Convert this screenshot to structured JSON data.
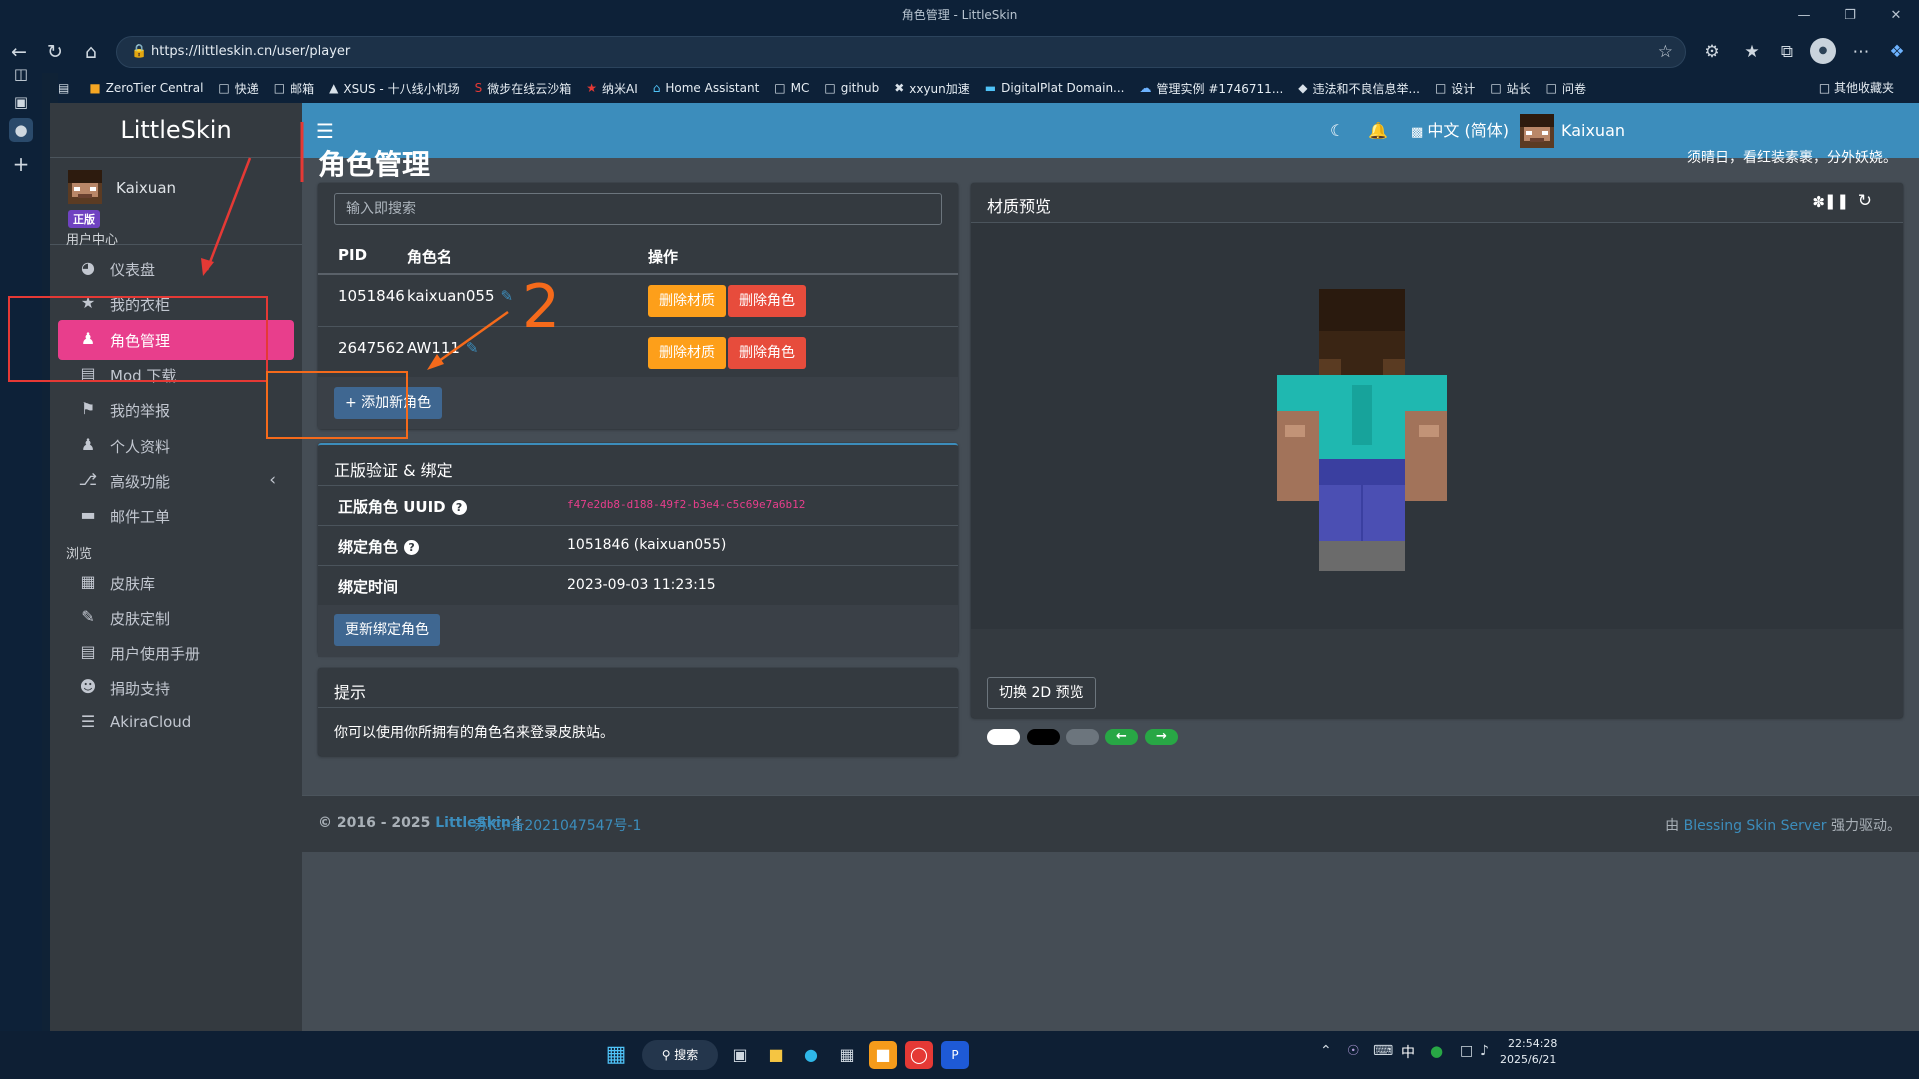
{
  "browser": {
    "window_title": "角色管理 - LittleSkin",
    "url": "https://littleskin.cn/user/player",
    "bookmarks": [
      "ZeroTier Central",
      "快递",
      "邮箱",
      "XSUS - 十八线小机场",
      "微步在线云沙箱",
      "纳米AI",
      "Home Assistant",
      "MC",
      "github",
      "xxyun加速",
      "DigitalPlat Domain...",
      "管理实例 #1746711...",
      "违法和不良信息举...",
      "设计",
      "站长",
      "问卷"
    ],
    "other_bookmarks": "其他收藏夹"
  },
  "app": {
    "brand": "LittleSkin",
    "user": {
      "name": "Kaixuan",
      "badge": "正版"
    },
    "nav_header_user": "用户中心",
    "nav_header_browse": "浏览",
    "nav_user": [
      {
        "label": "仪表盘",
        "icon": "dashboard-icon"
      },
      {
        "label": "我的衣柜",
        "icon": "star-icon"
      },
      {
        "label": "角色管理",
        "icon": "users-icon",
        "active": true
      },
      {
        "label": "Mod 下载",
        "icon": "book-icon"
      },
      {
        "label": "我的举报",
        "icon": "flag-icon"
      },
      {
        "label": "个人资料",
        "icon": "user-icon"
      },
      {
        "label": "高级功能",
        "icon": "branch-icon"
      },
      {
        "label": "邮件工单",
        "icon": "ticket-icon"
      }
    ],
    "nav_browse": [
      {
        "label": "皮肤库",
        "icon": "archive-icon"
      },
      {
        "label": "皮肤定制",
        "icon": "pencil-icon"
      },
      {
        "label": "用户使用手册",
        "icon": "book-icon"
      },
      {
        "label": "捐助支持",
        "icon": "donate-icon"
      },
      {
        "label": "AkiraCloud",
        "icon": "server-icon"
      }
    ],
    "topnav": {
      "language": "中文 (简体)",
      "user": "Kaixuan"
    },
    "page_title": "角色管理",
    "motd": "须晴日，看红装素裹，分外妖娆。",
    "players": {
      "search_placeholder": "输入即搜索",
      "columns": [
        "PID",
        "角色名",
        "操作"
      ],
      "rows": [
        {
          "pid": "1051846",
          "name": "kaixuan055"
        },
        {
          "pid": "2647562",
          "name": "AW111"
        }
      ],
      "delete_texture": "删除材质",
      "delete_player": "删除角色",
      "add_player": "+ 添加新角色"
    },
    "genuine": {
      "title": "正版验证 & 绑定",
      "uuid_label": "正版角色 UUID",
      "uuid": "f47e2db8-d188-49f2-b3e4-c5c69e7a6b12",
      "bound_label": "绑定角色",
      "bound": "1051846 (kaixuan055)",
      "time_label": "绑定时间",
      "time": "2023-09-03 11:23:15",
      "update_button": "更新绑定角色"
    },
    "tips": {
      "title": "提示",
      "text": "你可以使用你所拥有的角色名来登录皮肤站。"
    },
    "preview": {
      "title": "材质预览",
      "toggle_2d": "切换 2D 预览"
    },
    "footer": {
      "copyright": "© 2016 - 2025",
      "site": "LittleSkin",
      "icp": "苏ICP备2021047547号-1",
      "powered_prefix": "由",
      "powered_link": "Blessing Skin Server",
      "powered_suffix": "强力驱动。"
    }
  },
  "taskbar": {
    "search": "搜索",
    "time": "22:54:28",
    "date": "2025/6/21",
    "ime": "中"
  },
  "annotation": {
    "number": "2"
  },
  "colors": {
    "accent_blue": "#3c8dbc",
    "active_pink": "#e83e8c",
    "warning": "#fd9f1a",
    "danger": "#e74c3c",
    "annotation_red": "#e53935",
    "annotation_orange": "#f56a1b"
  }
}
